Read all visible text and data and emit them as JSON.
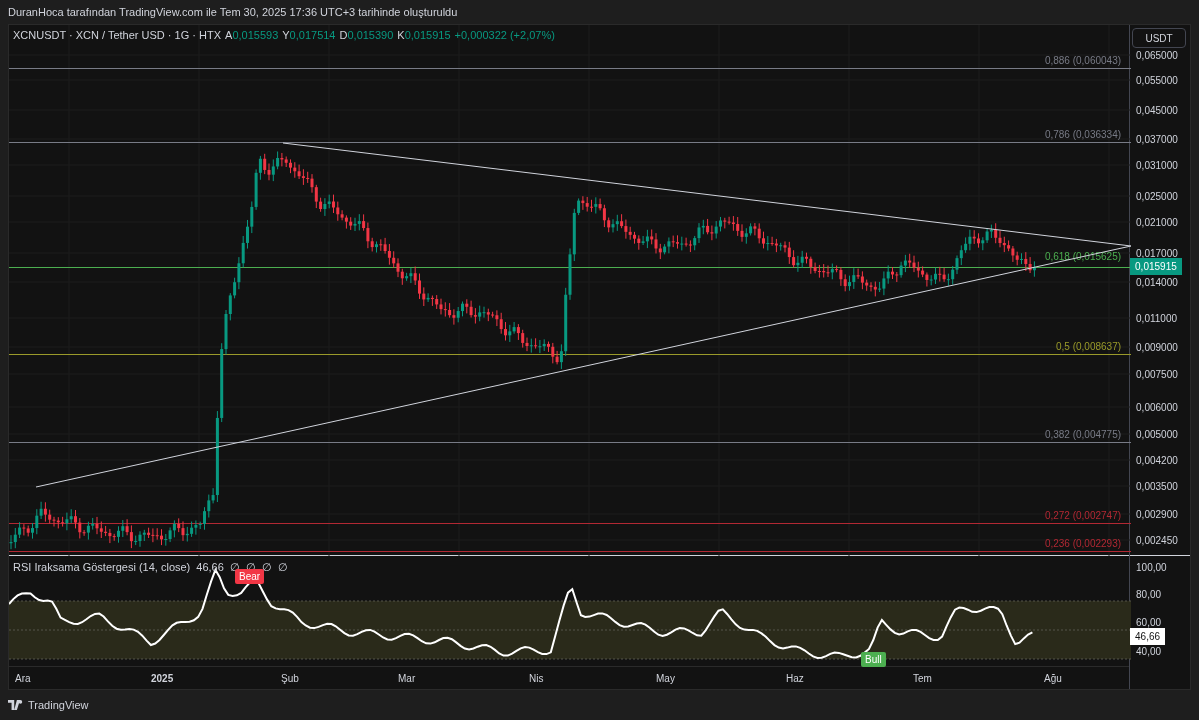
{
  "attribution": "DuranHoca tarafından TradingView.com ile Tem 30, 2025 17:36 UTC+3 tarihinde oluşturuldu",
  "legend": {
    "symbol": "XCNUSDT · XCN / Tether USD · 1G · HTX",
    "ohlc": [
      {
        "label": "A",
        "value": "0,015593"
      },
      {
        "label": "Y",
        "value": "0,017514"
      },
      {
        "label": "D",
        "value": "0,015390"
      },
      {
        "label": "K",
        "value": "0,015915"
      }
    ],
    "change": "+0,000322 (+2,07%)"
  },
  "currency_button": "USDT",
  "fib_levels": [
    {
      "label": "0,886 (0,060043)",
      "color": "#787b86"
    },
    {
      "label": "0,786 (0,036334)",
      "color": "#787b86"
    },
    {
      "label": "0,618 (0,015625)",
      "color": "#4caf50"
    },
    {
      "label": "0,5 (0,008637)",
      "color": "#9a9a2a"
    },
    {
      "label": "0,382 (0,004775)",
      "color": "#787b86"
    },
    {
      "label": "0,272 (0,002747)",
      "color": "#b22833"
    },
    {
      "label": "0,236 (0,002293)",
      "color": "#b22833"
    }
  ],
  "price_axis": [
    "0,065000",
    "0,055000",
    "0,045000",
    "0,037000",
    "0,031000",
    "0,025000",
    "0,021000",
    "0,017000",
    "0,014000",
    "0,011000",
    "0,009000",
    "0,007500",
    "0,006000",
    "0,005000",
    "0,004200",
    "0,003500",
    "0,002900",
    "0,002450"
  ],
  "last_price": "0,015915",
  "rsi": {
    "title": "RSI Iraksama Göstergesi (14, close)",
    "value": "46,66",
    "flags": [
      "∅",
      "∅",
      "∅",
      "∅"
    ],
    "bear_label": "Bear",
    "bull_label": "Bull",
    "axis": [
      "100,00",
      "80,00",
      "60,00",
      "40,00"
    ],
    "last_value": "46,66"
  },
  "time_axis": [
    "Ara",
    "2025",
    "Şub",
    "Mar",
    "Nis",
    "May",
    "Haz",
    "Tem",
    "Ağu"
  ],
  "footer": {
    "brand": "TradingView"
  }
}
